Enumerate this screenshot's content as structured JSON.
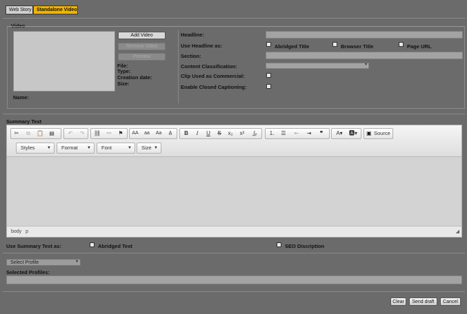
{
  "tabs": [
    {
      "label": "Web Story",
      "active": false
    },
    {
      "label": "Standalone Video",
      "active": true
    }
  ],
  "video": {
    "legend": "Video",
    "add_video": "Add Video",
    "remove_video": "Remove Video",
    "preview": "Preview",
    "file_label": "File:",
    "type_label": "Type:",
    "creation_label": "Creation date:",
    "size_label": "Size:",
    "name_label": "Name:"
  },
  "meta": {
    "headline_label": "Headline:",
    "use_headline_label": "Use Headline as:",
    "opt_abridged": "Abridged Title",
    "opt_browser": "Browser Title",
    "opt_page_url": "Page URL",
    "section_label": "Section:",
    "content_class_label": "Content Classification:",
    "commercial_label": "Clip Used as Commercial:",
    "captioning_label": "Enable Closed Captioning:"
  },
  "summary": {
    "label": "Summary Text",
    "source_label": "Source",
    "styles": "Styles",
    "format": "Format",
    "font": "Font",
    "size": "Size",
    "status_path": [
      "body",
      "p"
    ]
  },
  "use_summary": {
    "label": "Use Summary Text as:",
    "opt_abridged": "Abridged Text",
    "opt_seo": "SEO Discription"
  },
  "profiles": {
    "select": "Select Profile",
    "selected_label": "Selected Profiles:"
  },
  "actions": {
    "clear": "Clear",
    "send_draft": "Send draft",
    "cancel": "Cancel"
  },
  "colors": {
    "background": "#6b6b6b",
    "active_tab": "#f0b400",
    "field": "#a3a3a3"
  }
}
